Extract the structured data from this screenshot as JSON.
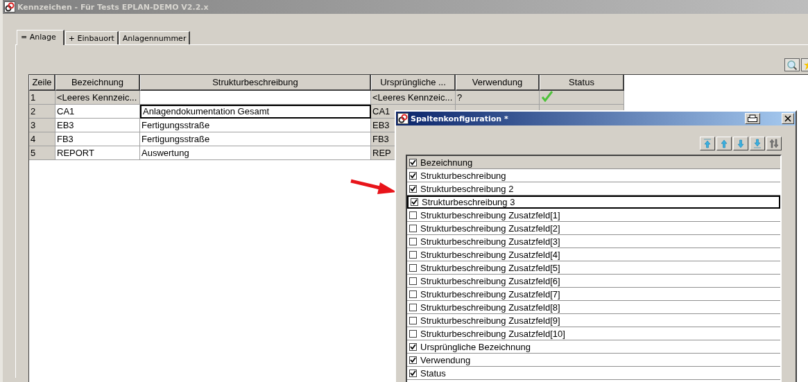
{
  "window": {
    "title": "Kennzeichen - Für Tests EPLAN-DEMO V2.2.x"
  },
  "tabs": [
    {
      "label": "= Anlage",
      "selected": true
    },
    {
      "label": "+ Einbauort",
      "selected": false
    },
    {
      "label": "Anlagennummer",
      "selected": false
    }
  ],
  "table": {
    "columns": [
      "Zeile",
      "Bezeichnung",
      "Strukturbeschreibung",
      "Ursprüngliche ...",
      "Verwendung",
      "Status"
    ],
    "rows": [
      {
        "kind": "empty",
        "zeile": "1",
        "bezeichnung": "<Leeres Kennzeic...",
        "struktur": "",
        "urspruenglich": "<Leeres Kennzeic...",
        "verwendung": "?",
        "status_ok": true,
        "focused": false
      },
      {
        "kind": "data",
        "zeile": "2",
        "bezeichnung": "CA1",
        "struktur": "Anlagendokumentation Gesamt",
        "urspruenglich": "CA1",
        "focused": true
      },
      {
        "kind": "data",
        "zeile": "3",
        "bezeichnung": "EB3",
        "struktur": "Fertigungsstraße",
        "urspruenglich": "EB3",
        "focused": false
      },
      {
        "kind": "data",
        "zeile": "4",
        "bezeichnung": "FB3",
        "struktur": "Fertigungsstraße",
        "urspruenglich": "FB3",
        "focused": false
      },
      {
        "kind": "data",
        "zeile": "5",
        "bezeichnung": "REPORT",
        "struktur": "Auswertung",
        "urspruenglich": "REP",
        "focused": false
      }
    ]
  },
  "dialog": {
    "title": "Spaltenkonfiguration *",
    "toolbar": [
      {
        "kind": "top",
        "disabled": false
      },
      {
        "kind": "up",
        "disabled": false
      },
      {
        "kind": "down",
        "disabled": false
      },
      {
        "kind": "bottom",
        "disabled": false
      },
      {
        "kind": "swap",
        "disabled": true
      }
    ],
    "items": [
      {
        "label": "Bezeichnung",
        "checked": true,
        "selected": false,
        "kind": "fixed"
      },
      {
        "label": "Strukturbeschreibung",
        "checked": true,
        "selected": false,
        "kind": "normal"
      },
      {
        "label": "Strukturbeschreibung 2",
        "checked": true,
        "selected": false,
        "kind": "normal"
      },
      {
        "label": "Strukturbeschreibung 3",
        "checked": true,
        "selected": true,
        "kind": "normal"
      },
      {
        "label": "Strukturbeschreibung Zusatzfeld[1]",
        "checked": false,
        "selected": false,
        "kind": "normal"
      },
      {
        "label": "Strukturbeschreibung Zusatzfeld[2]",
        "checked": false,
        "selected": false,
        "kind": "normal"
      },
      {
        "label": "Strukturbeschreibung Zusatzfeld[3]",
        "checked": false,
        "selected": false,
        "kind": "normal"
      },
      {
        "label": "Strukturbeschreibung Zusatzfeld[4]",
        "checked": false,
        "selected": false,
        "kind": "normal"
      },
      {
        "label": "Strukturbeschreibung Zusatzfeld[5]",
        "checked": false,
        "selected": false,
        "kind": "normal"
      },
      {
        "label": "Strukturbeschreibung Zusatzfeld[6]",
        "checked": false,
        "selected": false,
        "kind": "normal"
      },
      {
        "label": "Strukturbeschreibung Zusatzfeld[7]",
        "checked": false,
        "selected": false,
        "kind": "normal"
      },
      {
        "label": "Strukturbeschreibung Zusatzfeld[8]",
        "checked": false,
        "selected": false,
        "kind": "normal"
      },
      {
        "label": "Strukturbeschreibung Zusatzfeld[9]",
        "checked": false,
        "selected": false,
        "kind": "normal"
      },
      {
        "label": "Strukturbeschreibung Zusatzfeld[10]",
        "checked": false,
        "selected": false,
        "kind": "normal"
      },
      {
        "label": "Ursprüngliche Bezeichnung",
        "checked": true,
        "selected": false,
        "kind": "normal"
      },
      {
        "label": "Verwendung",
        "checked": true,
        "selected": false,
        "kind": "normal"
      },
      {
        "label": "Status",
        "checked": true,
        "selected": false,
        "kind": "normal"
      }
    ]
  }
}
